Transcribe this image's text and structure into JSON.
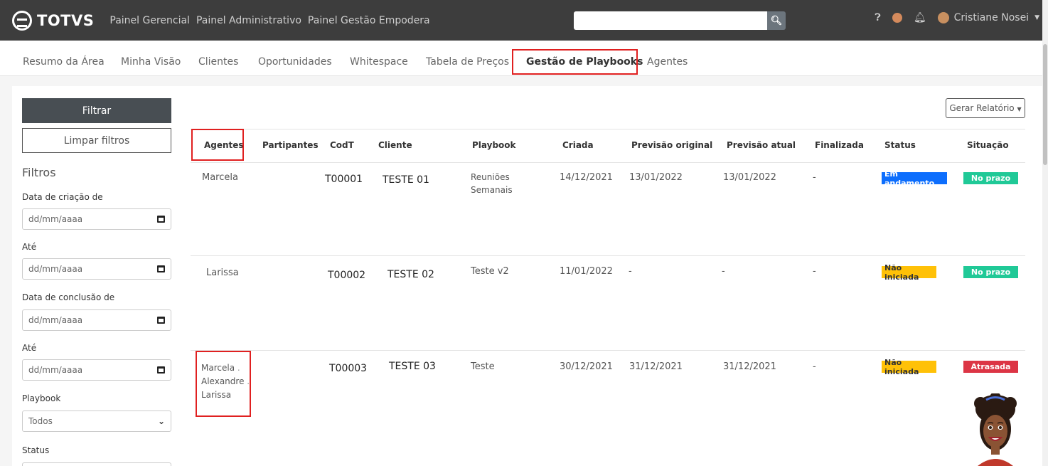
{
  "brand": "TOTVS",
  "topnav": [
    "Painel Gerencial",
    "Painel Administrativo",
    "Painel Gestão Empodera"
  ],
  "search": {
    "value": "",
    "button_icon": "search-icon"
  },
  "user": {
    "name": "Cristiane Nosei"
  },
  "subnav": [
    "Resumo da Área",
    "Minha Visão",
    "Clientes",
    "Oportunidades",
    "Whitespace",
    "Tabela de Preços",
    "Gestão de Playbooks",
    "Agentes"
  ],
  "sidebar": {
    "filter_button": "Filtrar",
    "clear_button": "Limpar filtros",
    "title": "Filtros",
    "created_from_label": "Data de criação de",
    "created_until_label": "Até",
    "completed_from_label": "Data de conclusão de",
    "completed_until_label": "Até",
    "date_placeholder": "dd/mm/aaaa",
    "playbook_label": "Playbook",
    "playbook_value": "Todos",
    "status_label": "Status"
  },
  "report_button": "Gerar Relatório",
  "table": {
    "headers": [
      "Agentes",
      "Partipantes",
      "CodT",
      "Cliente",
      "Playbook",
      "Criada",
      "Previsão original",
      "Previsão atual",
      "Finalizada",
      "Status",
      "Situação"
    ],
    "rows": [
      {
        "agentes": "Marcela",
        "codt": "T00001",
        "cliente": "TESTE 01",
        "playbook_1": "Reuniões",
        "playbook_2": "Semanais",
        "criada": "14/12/2021",
        "prev_orig": "13/01/2022",
        "prev_atual": "13/01/2022",
        "finalizada": "-",
        "status": "Em andamento",
        "situacao": "No prazo"
      },
      {
        "agentes": "Larissa",
        "codt": "T00002",
        "cliente": "TESTE 02",
        "playbook": "Teste v2",
        "criada": "11/01/2022",
        "prev_orig": "-",
        "prev_atual": "-",
        "finalizada": "-",
        "status": "Não iniciada",
        "situacao": "No prazo"
      },
      {
        "agentes_list": [
          "Marcela",
          "Alexandre",
          "Larissa"
        ],
        "codt": "T00003",
        "cliente": "TESTE 03",
        "playbook": "Teste",
        "criada": "30/12/2021",
        "prev_orig": "31/12/2021",
        "prev_atual": "31/12/2021",
        "finalizada": "-",
        "status": "Não iniciada",
        "situacao": "Atrasada"
      }
    ]
  },
  "colors": {
    "navbar": "#3d3d3d",
    "blue": "#0d6efd",
    "yellow": "#ffc107",
    "green": "#20c997",
    "red": "#dc3545",
    "highlight": "#e02020"
  }
}
